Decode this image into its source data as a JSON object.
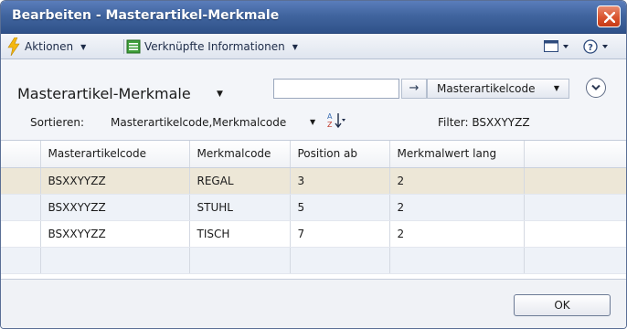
{
  "window": {
    "title": "Bearbeiten - Masterartikel-Merkmale"
  },
  "toolbar": {
    "actions_label": "Aktionen",
    "related_label": "Verknüpfte Informationen"
  },
  "header": {
    "page_title": "Masterartikel-Merkmale",
    "search_value": "",
    "search_field": "Masterartikelcode",
    "sort_label": "Sortieren:",
    "sort_value": "Masterartikelcode,Merkmalcode",
    "filter_text": "Filter: BSXXYYZZ"
  },
  "grid": {
    "columns": [
      "Masterartikelcode",
      "Merkmalcode",
      "Position ab",
      "Merkmalwert lang"
    ],
    "rows": [
      [
        "BSXXYYZZ",
        "REGAL",
        "3",
        "2"
      ],
      [
        "BSXXYYZZ",
        "STUHL",
        "5",
        "2"
      ],
      [
        "BSXXYYZZ",
        "TISCH",
        "7",
        "2"
      ]
    ]
  },
  "footer": {
    "ok_label": "OK"
  },
  "colors": {
    "titlebar": "#41659f",
    "selected_row": "#ede7d7",
    "close_button": "#d9542f"
  }
}
